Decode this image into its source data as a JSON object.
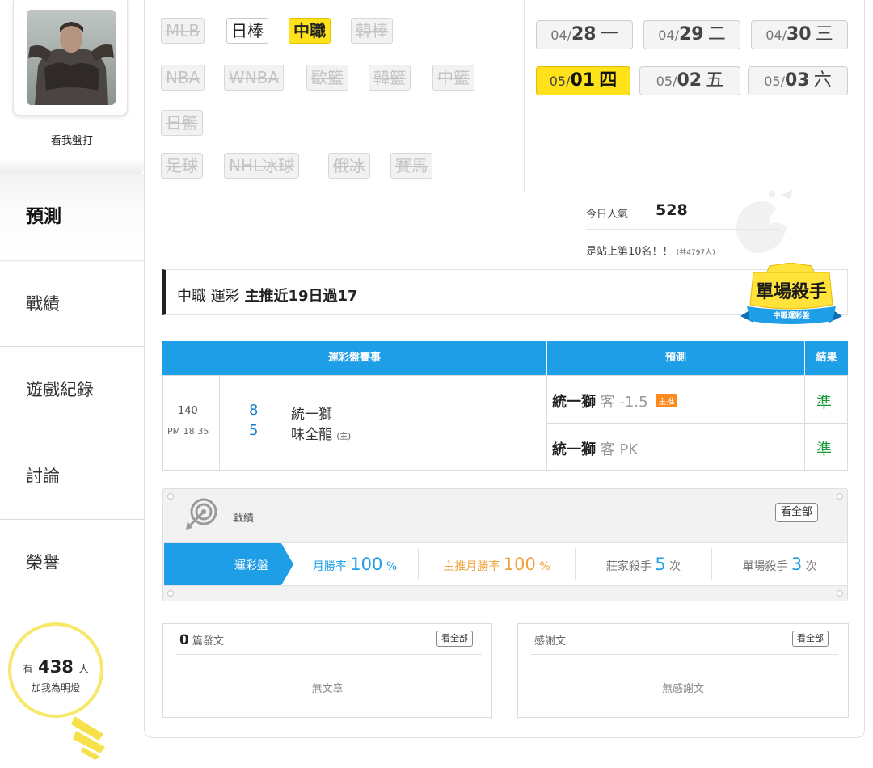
{
  "sidebar": {
    "username": "看我盤打",
    "nav": [
      {
        "label": "預測",
        "active": true
      },
      {
        "label": "戰績",
        "active": false
      },
      {
        "label": "遊戲紀錄",
        "active": false
      },
      {
        "label": "討論",
        "active": false
      },
      {
        "label": "榮譽",
        "active": false
      }
    ],
    "fans": {
      "prefix": "有",
      "count": "438",
      "suffix": "人",
      "label": "加我為明燈"
    }
  },
  "sports": [
    {
      "label": "MLB",
      "state": "disabled"
    },
    {
      "label": "日棒",
      "state": "on"
    },
    {
      "label": "中職",
      "state": "selected"
    },
    {
      "label": "韓棒",
      "state": "disabled"
    },
    {
      "label": "NBA",
      "state": "disabled"
    },
    {
      "label": "WNBA",
      "state": "disabled"
    },
    {
      "label": "歐籃",
      "state": "disabled"
    },
    {
      "label": "韓籃",
      "state": "disabled"
    },
    {
      "label": "中籃",
      "state": "disabled"
    },
    {
      "label": "日籃",
      "state": "disabled"
    },
    {
      "label": "足球",
      "state": "disabled"
    },
    {
      "label": "NHL冰球",
      "state": "disabled"
    },
    {
      "label": "俄冰",
      "state": "disabled"
    },
    {
      "label": "賽馬",
      "state": "disabled"
    }
  ],
  "dates": [
    {
      "month": "04/",
      "day": "28",
      "weekday": "一",
      "selected": false
    },
    {
      "month": "04/",
      "day": "29",
      "weekday": "二",
      "selected": false
    },
    {
      "month": "04/",
      "day": "30",
      "weekday": "三",
      "selected": false
    },
    {
      "month": "05/",
      "day": "01",
      "weekday": "四",
      "selected": true
    },
    {
      "month": "05/",
      "day": "02",
      "weekday": "五",
      "selected": false
    },
    {
      "month": "05/",
      "day": "03",
      "weekday": "六",
      "selected": false
    }
  ],
  "popularity": {
    "label": "今日人氣",
    "value": "528",
    "rank_text": "是站上第10名！！",
    "rank_total": "(共4797人)"
  },
  "headline": {
    "league": "中職",
    "type": "運彩",
    "highlight": "主推近19日過17",
    "badge_title": "單場殺手",
    "badge_sub": "中職運彩盤"
  },
  "table": {
    "headers": {
      "game": "運彩盤賽事",
      "prediction": "預測",
      "result": "結果"
    },
    "game": {
      "number": "140",
      "time": "PM 18:35",
      "away": {
        "score": "8",
        "team": "統一獅"
      },
      "home": {
        "score": "5",
        "team": "味全龍",
        "host_mark": "(主)"
      }
    },
    "predictions": [
      {
        "team": "統一獅",
        "side": "客",
        "line": "-1.5",
        "tag": "主推",
        "result": "準"
      },
      {
        "team": "統一獅",
        "side": "客",
        "line": "PK",
        "tag": "",
        "result": "準"
      }
    ]
  },
  "record": {
    "title": "戰績",
    "view_all": "看全部",
    "tab": "運彩盤",
    "stats": [
      {
        "label": "月勝率",
        "value": "100",
        "unit": "%"
      },
      {
        "label": "主推月勝率",
        "value": "100",
        "unit": "%"
      },
      {
        "label": "莊家殺手",
        "value": "5",
        "unit": "次"
      },
      {
        "label": "單場殺手",
        "value": "3",
        "unit": "次"
      }
    ]
  },
  "posts": {
    "count": "0",
    "label": "篇發文",
    "view_all": "看全部",
    "empty": "無文章"
  },
  "thanks": {
    "label": "感謝文",
    "view_all": "看全部",
    "empty": "無感謝文"
  },
  "colors": {
    "accent_blue": "#1e9ee7",
    "highlight_yellow": "#ffe21a",
    "win_green": "#1a9a3a",
    "orange": "#f0a23c"
  }
}
